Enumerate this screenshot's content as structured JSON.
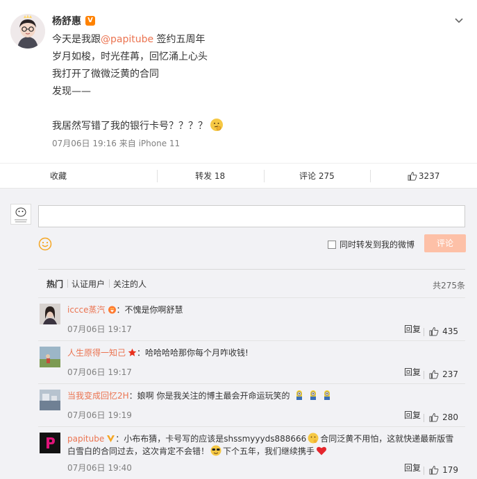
{
  "post": {
    "author": "杨舒惠",
    "content_lines": [
      "今天是我跟",
      "@papitube",
      " 签约五周年",
      "岁月如梭，时光荏苒，回忆涌上心头",
      "我打开了微微泛黄的合同",
      "发现——",
      "我居然写错了我的银行卡号？？？？"
    ],
    "meta": "07月06日 19:16  来自 iPhone 11"
  },
  "actions": {
    "favorite": "收藏",
    "repost": "转发 18",
    "comment": "评论 275",
    "like": "3237"
  },
  "composer": {
    "repost_label": "同时转发到我的微博",
    "submit_label": "评论"
  },
  "filter": {
    "tabs": [
      "热门",
      "认证用户",
      "关注的人"
    ],
    "total": "共275条"
  },
  "comments": [
    {
      "user": "iccce蒸汽",
      "text": "：不愧是你啊舒慧",
      "time": "07月06日 19:17",
      "reply": "回复",
      "likes": "435"
    },
    {
      "user": "人生原得一知己",
      "text": "：哈哈哈哈那你每个月咋收钱!",
      "time": "07月06日 19:17",
      "reply": "回复",
      "likes": "237"
    },
    {
      "user": "当我变成回忆2H",
      "text": "：娘啊 你是我关注的博主最会开命运玩笑的",
      "time": "07月06日 19:19",
      "reply": "回复",
      "likes": "280"
    },
    {
      "user": "papitube",
      "text_a": "：小布布猜，卡号写的应该是shssmyyyds888666",
      "text_b": "合同泛黄不用怕，这就快递最新版雪白雪白的合同过去，这次肯定不会错！",
      "text_c": "下个五年，我们继续携手",
      "time": "07月06日 19:40",
      "reply": "回复",
      "likes": "179"
    }
  ],
  "colors": {
    "accent": "#eb7350",
    "submit_bg": "#fdc0a7",
    "panel_bg": "#f2f2f5"
  }
}
